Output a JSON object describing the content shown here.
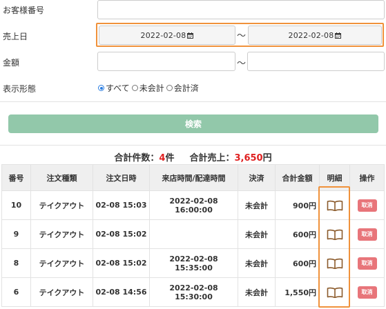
{
  "form": {
    "customer_number_label": "お客様番号",
    "customer_number_value": "",
    "sales_date_label": "売上日",
    "sales_date_from": "2022-02-08",
    "sales_date_to": "2022-02-08",
    "range_separator": "〜",
    "amount_label": "金額",
    "amount_from": "",
    "amount_to": "",
    "display_label": "表示形態",
    "display_options": [
      {
        "label": "すべて",
        "checked": true
      },
      {
        "label": "未会計",
        "checked": false
      },
      {
        "label": "会計済",
        "checked": false
      }
    ],
    "search_button": "検索"
  },
  "summary": {
    "count_label": "合計件数：",
    "count_value": "4",
    "count_unit": "件",
    "sales_label": "合計売上：",
    "sales_value": "3,650",
    "sales_unit": "円"
  },
  "table": {
    "headers": [
      "番号",
      "注文種類",
      "注文日時",
      "来店時間/配達時間",
      "決済",
      "合計金額",
      "明細",
      "操作"
    ],
    "rows": [
      {
        "no": "10",
        "type": "テイクアウト",
        "ordered": "02-08 15:03",
        "visit": "2022-02-08 16:00:00",
        "payment": "未会計",
        "total": "900円",
        "action": "取消"
      },
      {
        "no": "9",
        "type": "テイクアウト",
        "ordered": "02-08 15:02",
        "visit": "",
        "payment": "未会計",
        "total": "600円",
        "action": "取消"
      },
      {
        "no": "8",
        "type": "テイクアウト",
        "ordered": "02-08 15:02",
        "visit": "2022-02-08 15:35:00",
        "payment": "未会計",
        "total": "600円",
        "action": "取消"
      },
      {
        "no": "6",
        "type": "テイクアウト",
        "ordered": "02-08 14:56",
        "visit": "2022-02-08 15:30:00",
        "payment": "未会計",
        "total": "1,550円",
        "action": "取消"
      }
    ]
  },
  "colors": {
    "highlight": "#f0913a",
    "search_button": "#92c8aa",
    "cancel_button": "#e8757a",
    "count_number": "#e02020",
    "book_icon": "#8b5a2b"
  },
  "icons": {
    "date": "calendar-icon",
    "detail": "book-icon"
  }
}
